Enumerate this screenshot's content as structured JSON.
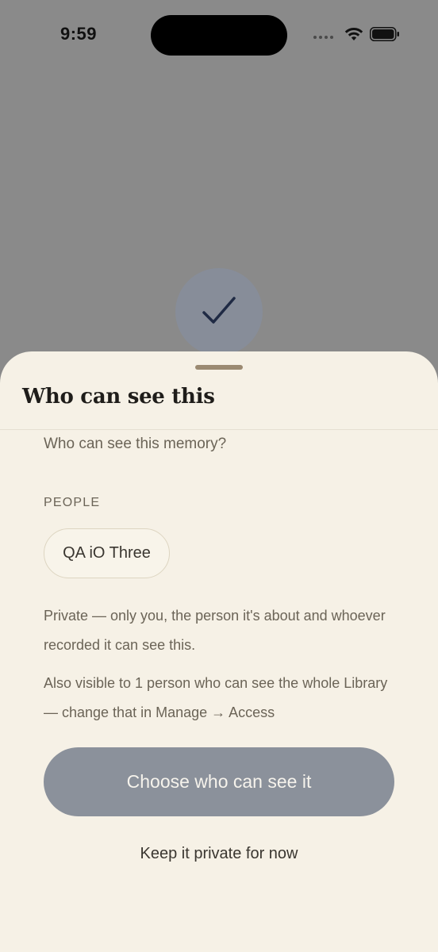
{
  "status_bar": {
    "time": "9:59",
    "icons": [
      "cellular-signal-icon",
      "wifi-icon",
      "battery-icon"
    ]
  },
  "backdrop": {
    "badge_icon": "checkmark-icon"
  },
  "sheet": {
    "title": "Who can see this",
    "question": "Who can see this memory?",
    "people_label": "PEOPLE",
    "people": [
      "QA iO Three"
    ],
    "private_note": "Private — only you, the person it's about and whoever recorded it can see this.",
    "library_note": "Also visible to 1 person who can see the whole Library — change that in Manage → Access",
    "primary_button": "Choose who can see it",
    "secondary_button": "Keep it private for now"
  },
  "colors": {
    "backdrop": "#8a8a8a",
    "sheet_background": "#f6f1e6",
    "primary_button": "#8b919b",
    "handle": "#9b8a72",
    "check_stroke": "#1f2a44"
  }
}
